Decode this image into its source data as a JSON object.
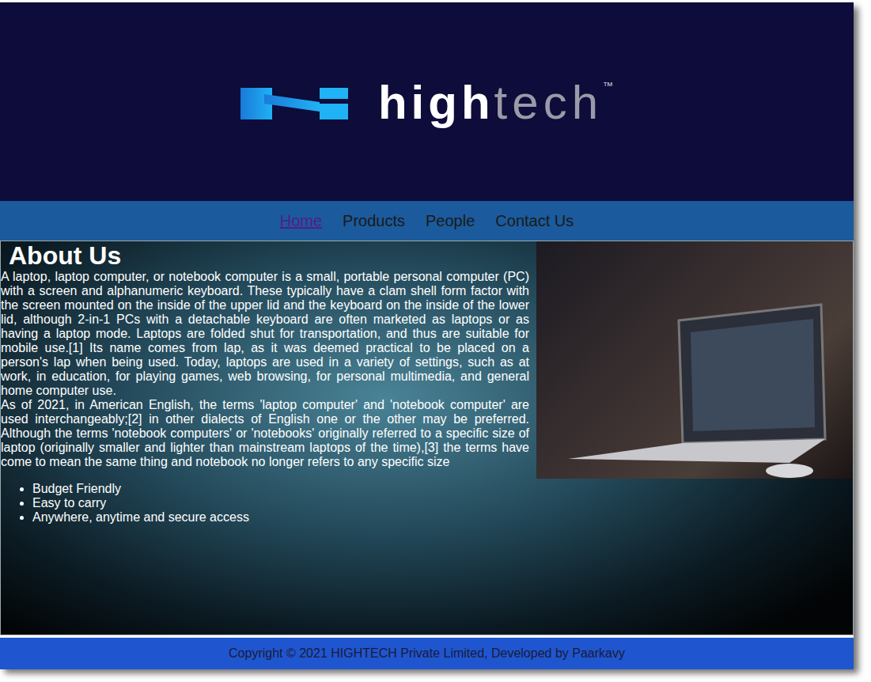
{
  "logo": {
    "text_primary": "high",
    "text_secondary": "tech",
    "trademark": "™"
  },
  "nav": [
    {
      "label": "Home",
      "selected": true
    },
    {
      "label": "Products",
      "selected": false
    },
    {
      "label": "People",
      "selected": false
    },
    {
      "label": "Contact Us",
      "selected": false
    }
  ],
  "about": {
    "title": "About Us",
    "paragraphs": [
      "A laptop, laptop computer, or notebook computer is a small, portable personal computer (PC) with a screen and alphanumeric keyboard. These typically have a clam shell form factor with the screen mounted on the inside of the upper lid and the keyboard on the inside of the lower lid, although 2-in-1 PCs with a detachable keyboard are often marketed as laptops or as having a laptop mode. Laptops are folded shut for transportation, and thus are suitable for mobile use.[1] Its name comes from lap, as it was deemed practical to be placed on a person's lap when being used. Today, laptops are used in a variety of settings, such as at work, in education, for playing games, web browsing, for personal multimedia, and general home computer use.",
      "As of 2021, in American English, the terms 'laptop computer' and 'notebook computer' are used interchangeably;[2] in other dialects of English one or the other may be preferred. Although the terms 'notebook computers' or 'notebooks' originally referred to a specific size of laptop (originally smaller and lighter than mainstream laptops of the time),[3] the terms have come to mean the same thing and notebook no longer refers to any specific size"
    ],
    "features": [
      "Budget Friendly",
      "Easy to carry",
      "Anywhere, anytime and secure access"
    ]
  },
  "footer": "Copyright © 2021 HIGHTECH Private Limited, Developed by Paarkavy"
}
